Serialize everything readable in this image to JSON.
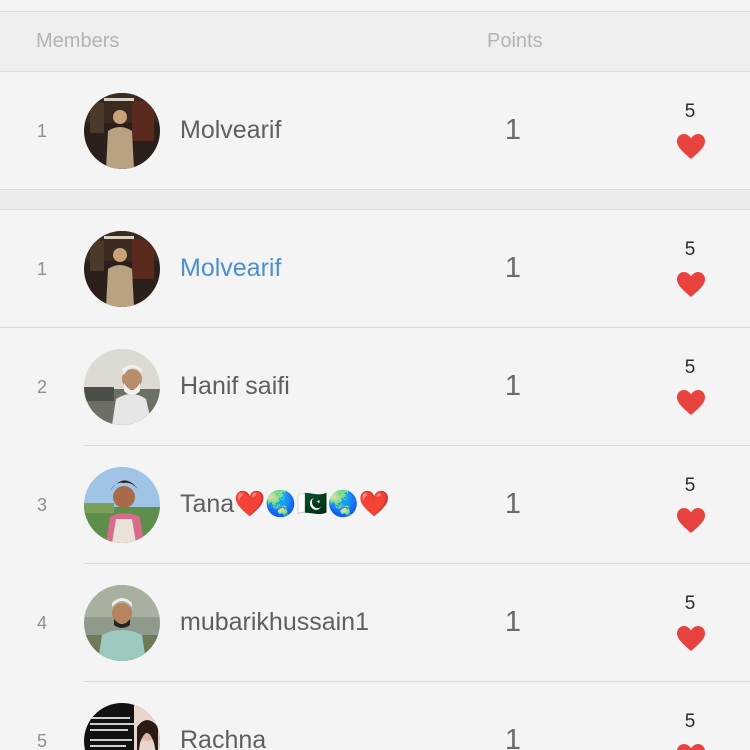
{
  "header": {
    "members_label": "Members",
    "points_label": "Points"
  },
  "current_user": {
    "rank": "1",
    "name": "Molvearif",
    "points": "1",
    "likes": "5"
  },
  "leaderboard": [
    {
      "rank": "1",
      "name": "Molvearif",
      "points": "1",
      "likes": "5"
    },
    {
      "rank": "2",
      "name": "Hanif saifi",
      "points": "1",
      "likes": "5"
    },
    {
      "rank": "3",
      "name": "Tana❤️🌏🇵🇰🌏❤️",
      "points": "1",
      "likes": "5"
    },
    {
      "rank": "4",
      "name": "mubarikhussain1",
      "points": "1",
      "likes": "5"
    },
    {
      "rank": "5",
      "name": "Rachna",
      "points": "1",
      "likes": "5"
    }
  ],
  "colors": {
    "accent_link": "#4a90d2",
    "heart": "#e8423f",
    "header_text": "#b4b4b4"
  },
  "icons": {
    "like": "heart-icon"
  }
}
